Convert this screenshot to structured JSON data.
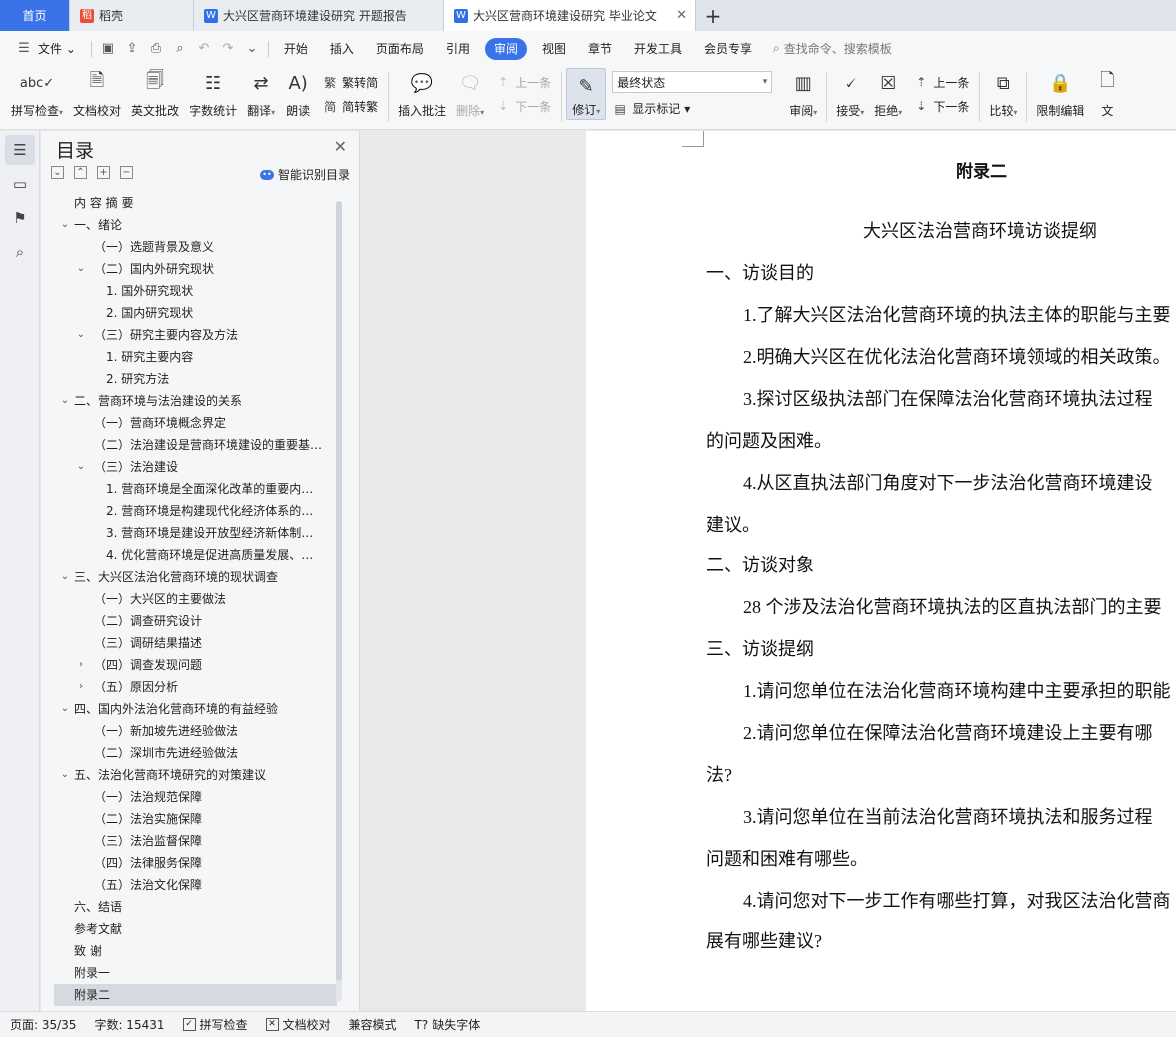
{
  "tabs": [
    {
      "label": "首页"
    },
    {
      "label": "稻壳"
    },
    {
      "label": "大兴区营商环境建设研究 开题报告"
    },
    {
      "label": "大兴区营商环境建设研究 毕业论文"
    }
  ],
  "menubar": {
    "file": "文件",
    "items": [
      "开始",
      "插入",
      "页面布局",
      "引用",
      "审阅",
      "视图",
      "章节",
      "开发工具",
      "会员专享"
    ],
    "search": "查找命令、搜索模板"
  },
  "ribbon": {
    "spell": "拼写检查",
    "doccheck": "文档校对",
    "engreview": "英文批改",
    "wordcount": "字数统计",
    "translate": "翻译",
    "read": "朗读",
    "trad": "繁转简",
    "simp": "简转繁",
    "insert_comment": "插入批注",
    "delete": "删除",
    "prev": "上一条",
    "next": "下一条",
    "revise": "修订",
    "final_state": "最终状态",
    "show_marks": "显示标记",
    "review": "审阅",
    "accept": "接受",
    "reject": "拒绝",
    "prev2": "上一条",
    "next2": "下一条",
    "compare": "比较",
    "restrict": "限制编辑",
    "doc_cut": "文"
  },
  "toc": {
    "title": "目录",
    "smart": "智能识别目录",
    "items": [
      "内 容 摘 要",
      "一、绪论",
      "（一）选题背景及意义",
      "（二）国内外研究现状",
      "1. 国外研究现状",
      "2. 国内研究现状",
      "（三）研究主要内容及方法",
      "1. 研究主要内容",
      "2. 研究方法",
      "二、营商环境与法治建设的关系",
      "（一）营商环境概念界定",
      "（二）法治建设是营商环境建设的重要基…",
      "（三）法治建设",
      "1. 营商环境是全面深化改革的重要内…",
      "2. 营商环境是构建现代化经济体系的…",
      "3. 营商环境是建设开放型经济新体制…",
      "4. 优化营商环境是促进高质量发展、…",
      "三、大兴区法治化营商环境的现状调查",
      "（一）大兴区的主要做法",
      "（二）调查研究设计",
      "（三）调研结果描述",
      "（四）调查发现问题",
      "（五）原因分析",
      "四、国内外法治化营商环境的有益经验",
      "（一）新加坡先进经验做法",
      "（二）深圳市先进经验做法",
      "五、法治化营商环境研究的对策建议",
      "（一）法治规范保障",
      "（二）法治实施保障",
      "（三）法治监督保障",
      "（四）法律服务保障",
      "（五）法治文化保障",
      "六、结语",
      "参考文献",
      "致 谢",
      "附录一",
      "附录二"
    ]
  },
  "doc": {
    "heading": "附录二",
    "title": "大兴区法治营商环境访谈提纲",
    "s1": "一、访谈目的",
    "p1": "1.了解大兴区法治化营商环境的执法主体的职能与主要",
    "p2": "2.明确大兴区在优化法治化营商环境领域的相关政策。",
    "p3a": "3.探讨区级执法部门在保障法治化营商环境执法过程",
    "p3b": "的问题及困难。",
    "p4a": "4.从区直执法部门角度对下一步法治化营商环境建设",
    "p4b": "建议。",
    "s2": "二、访谈对象",
    "p5": "28 个涉及法治化营商环境执法的区直执法部门的主要",
    "s3": "三、访谈提纲",
    "q1": "1.请问您单位在法治化营商环境构建中主要承担的职能",
    "q2a": "2.请问您单位在保障法治化营商环境建设上主要有哪",
    "q2b": "法?",
    "q3a": "3.请问您单位在当前法治化营商环境执法和服务过程",
    "q3b": "问题和困难有哪些。",
    "q4a": "4.请问您对下一步工作有哪些打算，对我区法治化营商",
    "q4b": "展有哪些建议?"
  },
  "status": {
    "page": "页面: 35/35",
    "words": "字数: 15431",
    "spell": "拼写检查",
    "doccheck": "文档校对",
    "compat": "兼容模式",
    "missing_font": "缺失字体"
  }
}
